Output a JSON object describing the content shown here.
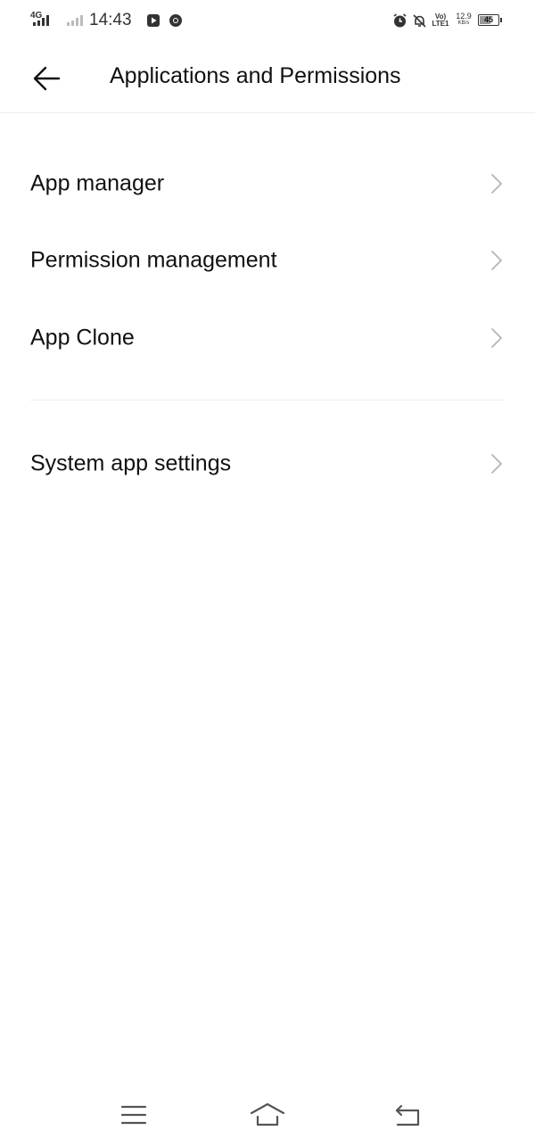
{
  "status_bar": {
    "network": "4G",
    "time": "14:43",
    "volte_line1": "Vo)",
    "volte_line2": "LTE1",
    "speed_value": "12.9",
    "speed_unit": "KB/s",
    "battery": "45",
    "icons": [
      "signal-icon",
      "signal-weak-icon",
      "youtube-icon",
      "chrome-icon",
      "alarm-icon",
      "bell-off-icon",
      "battery-icon"
    ]
  },
  "header": {
    "back_icon": "arrow-left-icon",
    "title": "Applications and Permissions"
  },
  "menu": {
    "items": [
      {
        "label": "App manager"
      },
      {
        "label": "Permission management"
      },
      {
        "label": "App Clone"
      },
      {
        "label": "System app settings"
      }
    ]
  },
  "nav_bar": {
    "icons": [
      "menu-icon",
      "home-icon",
      "back-icon"
    ]
  },
  "colors": {
    "text": "#111111",
    "chevron": "#b5b5b5",
    "divider": "#ececec",
    "background": "#ffffff"
  }
}
